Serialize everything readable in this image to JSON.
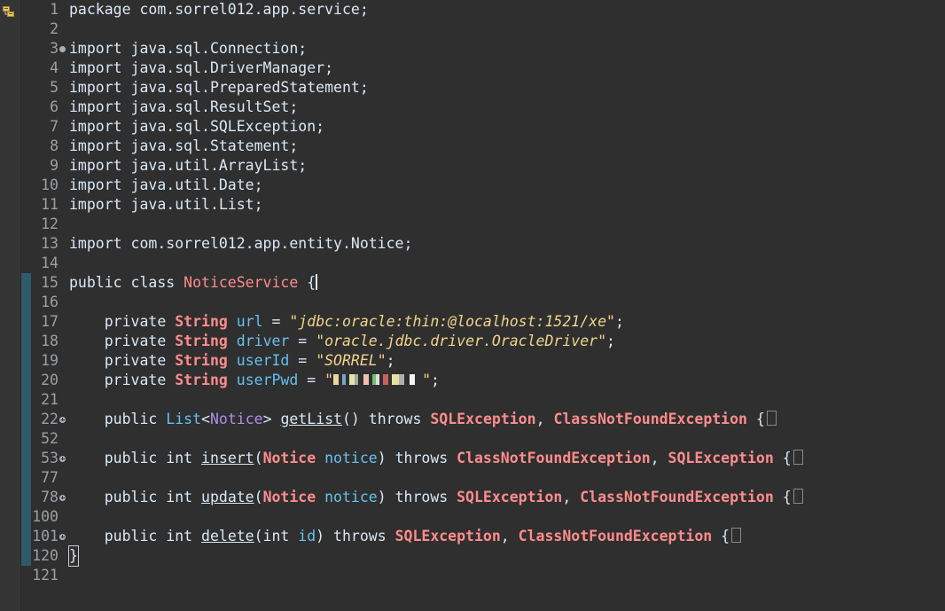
{
  "editor": {
    "ruler_icon": "file-structure-icon",
    "lines": [
      {
        "n": "1",
        "tokens": [
          [
            "kw",
            "package com.sorrel012.app.service;"
          ]
        ]
      },
      {
        "n": "2",
        "tokens": []
      },
      {
        "n": "3",
        "fold": "dot",
        "tokens": [
          [
            "kw",
            "import java.sql.Connection;"
          ]
        ]
      },
      {
        "n": "4",
        "tokens": [
          [
            "kw",
            "import java.sql.DriverManager;"
          ]
        ]
      },
      {
        "n": "5",
        "tokens": [
          [
            "kw",
            "import java.sql.PreparedStatement;"
          ]
        ]
      },
      {
        "n": "6",
        "tokens": [
          [
            "kw",
            "import java.sql.ResultSet;"
          ]
        ]
      },
      {
        "n": "7",
        "tokens": [
          [
            "kw",
            "import java.sql.SQLException;"
          ]
        ]
      },
      {
        "n": "8",
        "tokens": [
          [
            "kw",
            "import java.sql.Statement;"
          ]
        ]
      },
      {
        "n": "9",
        "tokens": [
          [
            "kw",
            "import java.util.ArrayList;"
          ]
        ]
      },
      {
        "n": "10",
        "tokens": [
          [
            "kw",
            "import java.util.Date;"
          ]
        ]
      },
      {
        "n": "11",
        "tokens": [
          [
            "kw",
            "import java.util.List;"
          ]
        ]
      },
      {
        "n": "12",
        "tokens": []
      },
      {
        "n": "13",
        "tokens": [
          [
            "kw",
            "import com.sorrel012.app.entity.Notice;"
          ]
        ]
      },
      {
        "n": "14",
        "tokens": []
      },
      {
        "n": "15",
        "changed": true,
        "tokens": [
          [
            "kw",
            "public class "
          ],
          [
            "cls-n",
            "NoticeService"
          ],
          [
            "kw",
            " {"
          ],
          [
            "cursor",
            ""
          ]
        ]
      },
      {
        "n": "16",
        "changed": true,
        "tokens": []
      },
      {
        "n": "17",
        "changed": true,
        "tokens": [
          [
            "kw",
            "    private "
          ],
          [
            "cls",
            "String"
          ],
          [
            "kw",
            " "
          ],
          [
            "field",
            "url"
          ],
          [
            "kw",
            " = "
          ],
          [
            "str",
            "\"jdbc:oracle:thin:@localhost:1521/xe\""
          ],
          [
            "kw",
            ";"
          ]
        ]
      },
      {
        "n": "18",
        "changed": true,
        "tokens": [
          [
            "kw",
            "    private "
          ],
          [
            "cls",
            "String"
          ],
          [
            "kw",
            " "
          ],
          [
            "field",
            "driver"
          ],
          [
            "kw",
            " = "
          ],
          [
            "str",
            "\"oracle.jdbc.driver.OracleDriver\""
          ],
          [
            "kw",
            ";"
          ]
        ]
      },
      {
        "n": "19",
        "changed": true,
        "tokens": [
          [
            "kw",
            "    private "
          ],
          [
            "cls",
            "String"
          ],
          [
            "kw",
            " "
          ],
          [
            "field",
            "userId"
          ],
          [
            "kw",
            " = "
          ],
          [
            "str",
            "\"SORREL\""
          ],
          [
            "kw",
            ";"
          ]
        ]
      },
      {
        "n": "20",
        "changed": true,
        "tokens": [
          [
            "kw",
            "    private "
          ],
          [
            "cls",
            "String"
          ],
          [
            "kw",
            " "
          ],
          [
            "field",
            "userPwd"
          ],
          [
            "kw",
            " = "
          ],
          [
            "str",
            "\""
          ],
          [
            "redact",
            ""
          ],
          [
            "str",
            "\""
          ],
          [
            "kw",
            ";"
          ]
        ]
      },
      {
        "n": "21",
        "changed": true,
        "tokens": []
      },
      {
        "n": "22",
        "changed": true,
        "fold": "expand",
        "tokens": [
          [
            "kw",
            "    public "
          ],
          [
            "field",
            "List"
          ],
          [
            "kw",
            "<"
          ],
          [
            "type-ref",
            "Notice"
          ],
          [
            "kw",
            "> "
          ],
          [
            "method",
            "getList"
          ],
          [
            "kw",
            "() throws "
          ],
          [
            "cls",
            "SQLException"
          ],
          [
            "kw",
            ", "
          ],
          [
            "cls",
            "ClassNotFoundException"
          ],
          [
            "kw",
            " {"
          ],
          [
            "box",
            ""
          ]
        ]
      },
      {
        "n": "52",
        "changed": true,
        "tokens": []
      },
      {
        "n": "53",
        "changed": true,
        "fold": "expand",
        "tokens": [
          [
            "kw",
            "    public int "
          ],
          [
            "method",
            "insert"
          ],
          [
            "kw",
            "("
          ],
          [
            "cls",
            "Notice"
          ],
          [
            "kw",
            " "
          ],
          [
            "param",
            "notice"
          ],
          [
            "kw",
            ") throws "
          ],
          [
            "cls",
            "ClassNotFoundException"
          ],
          [
            "kw",
            ", "
          ],
          [
            "cls",
            "SQLException"
          ],
          [
            "kw",
            " {"
          ],
          [
            "box",
            ""
          ]
        ]
      },
      {
        "n": "77",
        "changed": true,
        "tokens": []
      },
      {
        "n": "78",
        "changed": true,
        "fold": "expand",
        "tokens": [
          [
            "kw",
            "    public int "
          ],
          [
            "method",
            "update"
          ],
          [
            "kw",
            "("
          ],
          [
            "cls",
            "Notice"
          ],
          [
            "kw",
            " "
          ],
          [
            "param",
            "notice"
          ],
          [
            "kw",
            ") throws "
          ],
          [
            "cls",
            "SQLException"
          ],
          [
            "kw",
            ", "
          ],
          [
            "cls",
            "ClassNotFoundException"
          ],
          [
            "kw",
            " {"
          ],
          [
            "box",
            ""
          ]
        ]
      },
      {
        "n": "100",
        "changed": true,
        "tokens": []
      },
      {
        "n": "101",
        "changed": true,
        "fold": "expand",
        "tokens": [
          [
            "kw",
            "    public int "
          ],
          [
            "method",
            "delete"
          ],
          [
            "kw",
            "(int "
          ],
          [
            "param",
            "id"
          ],
          [
            "kw",
            ") throws "
          ],
          [
            "cls",
            "SQLException"
          ],
          [
            "kw",
            ", "
          ],
          [
            "cls",
            "ClassNotFoundException"
          ],
          [
            "kw",
            " {"
          ],
          [
            "box",
            ""
          ]
        ]
      },
      {
        "n": "120",
        "changed": true,
        "tokens": [
          [
            "brace",
            "}"
          ]
        ]
      },
      {
        "n": "121",
        "tokens": []
      }
    ]
  }
}
